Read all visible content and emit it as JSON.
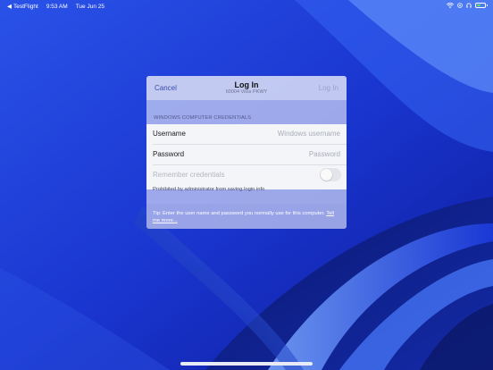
{
  "status_bar": {
    "back_app": "TestFlight",
    "time": "9:53 AM",
    "date": "Tue Jun 25",
    "icons": [
      "wifi-icon",
      "orientation-lock-icon",
      "headphones-icon",
      "battery-icon"
    ],
    "battery_level": 0.55,
    "battery_color": "#5fe06b"
  },
  "dialog": {
    "cancel_label": "Cancel",
    "title": "Log In",
    "subtitle": "60004 Voss PKWY",
    "login_label": "Log In",
    "section_header": "WINDOWS COMPUTER CREDENTIALS",
    "username": {
      "label": "Username",
      "placeholder": "Windows username"
    },
    "password": {
      "label": "Password",
      "placeholder": "Password"
    },
    "remember": {
      "label": "Remember credentials",
      "enabled": false
    },
    "footnote": "Prohibited by administrator from saving login info",
    "tip_text": "Tip: Enter the user name and password you normally use for this computer.",
    "tip_link": "Tell me more..."
  },
  "colors": {
    "accent": "#3a4da8",
    "wallpaper": "#1d3ad8"
  }
}
